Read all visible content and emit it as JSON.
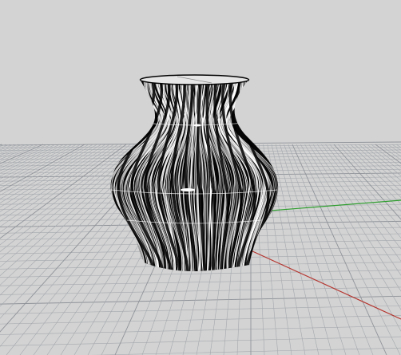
{
  "viewport": {
    "background_color": "#d3d3d3",
    "grid_color": "#a4a8ad",
    "grid_major_color": "#8f9399",
    "axis_x_color": "#b5352f",
    "axis_y_color": "#2e9e2e",
    "object": {
      "name": "vase",
      "display_mode": "wireframe",
      "wire_color": "#ffffff",
      "body_color": "#050505"
    }
  }
}
